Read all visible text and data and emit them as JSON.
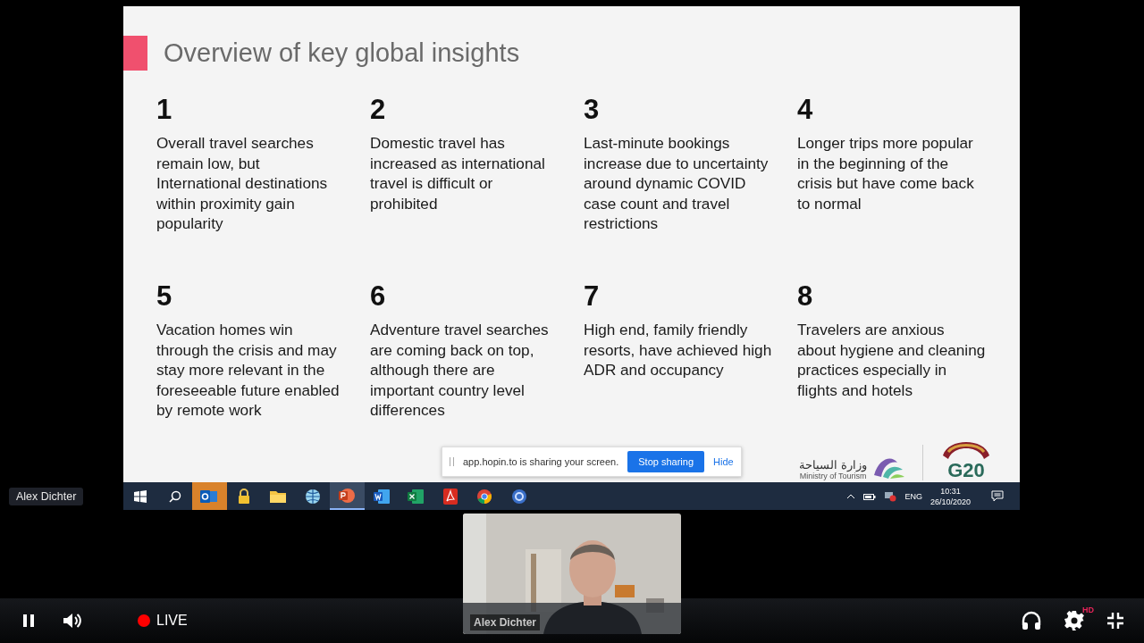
{
  "slide": {
    "title": "Overview of key global insights",
    "insights": [
      {
        "number": "1",
        "text": "Overall travel searches remain low, but International destinations within proximity gain popularity"
      },
      {
        "number": "2",
        "text": "Domestic travel has increased as international travel is difficult or prohibited"
      },
      {
        "number": "3",
        "text": "Last-minute bookings increase due to uncertainty around dynamic COVID case count and travel restrictions"
      },
      {
        "number": "4",
        "text": "Longer trips more popular in the beginning of the crisis but have come back to normal"
      },
      {
        "number": "5",
        "text": "Vacation homes win through the crisis and may stay more relevant in the foreseeable future enabled by remote work"
      },
      {
        "number": "6",
        "text": "Adventure travel searches are coming back on top, although there are important country level differences"
      },
      {
        "number": "7",
        "text": "High end, family friendly resorts, have achieved high ADR and occupancy"
      },
      {
        "number": "8",
        "text": "Travelers are anxious about hygiene and cleaning practices especially in flights and hotels"
      }
    ],
    "ministry_arabic": "وزارة السياحة",
    "ministry_english": "Ministry of Tourism",
    "g20": "G20"
  },
  "share_bar": {
    "message": "app.hopin.to is sharing your screen.",
    "stop_button": "Stop sharing",
    "hide_link": "Hide"
  },
  "taskbar": {
    "apps": [
      {
        "kind": "windows",
        "attention": false,
        "selected": false
      },
      {
        "kind": "search",
        "attention": false,
        "selected": false
      },
      {
        "kind": "outlook",
        "attention": true,
        "selected": false
      },
      {
        "kind": "lock",
        "attention": false,
        "selected": false
      },
      {
        "kind": "folder",
        "attention": false,
        "selected": false
      },
      {
        "kind": "globe",
        "attention": false,
        "selected": false
      },
      {
        "kind": "powerpoint",
        "attention": false,
        "selected": true
      },
      {
        "kind": "word",
        "attention": false,
        "selected": false
      },
      {
        "kind": "excel",
        "attention": false,
        "selected": false
      },
      {
        "kind": "acrobat",
        "attention": false,
        "selected": false
      },
      {
        "kind": "chrome",
        "attention": false,
        "selected": false
      },
      {
        "kind": "app",
        "attention": false,
        "selected": false
      }
    ],
    "language": "ENG",
    "time": "10:31",
    "date": "26/10/2020"
  },
  "presenter_tag": "Alex Dichter",
  "video": {
    "name_overlay": "Alex Dichter"
  },
  "player": {
    "live_label": "LIVE",
    "hd_badge": "HD"
  }
}
